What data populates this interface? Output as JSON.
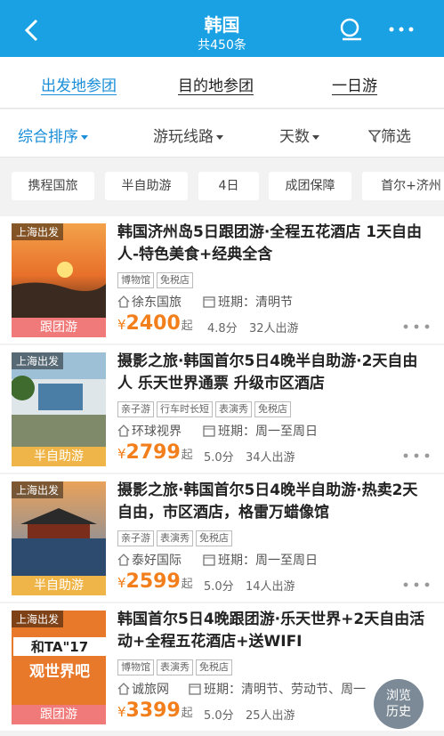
{
  "header": {
    "title": "韩国",
    "count": "共450条",
    "back_icon": "back-arrow-icon",
    "search_icon": "search-icon",
    "more_icon": "more-dots-icon"
  },
  "tabs": [
    "出发地参团",
    "目的地参团",
    "一日游"
  ],
  "filters": [
    "综合排序",
    "游玩线路",
    "天数",
    "筛选"
  ],
  "chips": [
    "携程国旅",
    "半自助游",
    "4日",
    "成团保障",
    "首尔+济州"
  ],
  "products": [
    {
      "origin": "上海出发",
      "title": "韩国济州岛5日跟团游·全程五花酒店 1天自由人-特色美食+经典全含",
      "badges": [
        "博物馆",
        "免税店"
      ],
      "agency": "徐东国旅",
      "schedule": "班期：清明节",
      "yen": "¥",
      "price": "2400",
      "qi": "起",
      "score": "4.8分",
      "travelers": "32人出游",
      "tag": "跟团游"
    },
    {
      "origin": "上海出发",
      "title": "摄影之旅·韩国首尔5日4晚半自助游·2天自由人 乐天世界通票 升级市区酒店",
      "badges": [
        "亲子游",
        "行车时长短",
        "表演秀",
        "免税店"
      ],
      "agency": "环球视界",
      "schedule": "班期：周一至周日",
      "yen": "¥",
      "price": "2799",
      "qi": "起",
      "score": "5.0分",
      "travelers": "34人出游",
      "tag": "半自助游"
    },
    {
      "origin": "上海出发",
      "title": "摄影之旅·韩国首尔5日4晚半自助游·热卖2天自由，市区酒店，格雷万蜡像馆",
      "badges": [
        "亲子游",
        "表演秀",
        "免税店"
      ],
      "agency": "泰好国际",
      "schedule": "班期：周一至周日",
      "yen": "¥",
      "price": "2599",
      "qi": "起",
      "score": "5.0分",
      "travelers": "14人出游",
      "tag": "半自助游"
    },
    {
      "origin": "上海出发",
      "title": "韩国首尔5日4晚跟团游·乐天世界+2天自由活动+全程五花酒店+送WIFI",
      "badges": [
        "博物馆",
        "表演秀",
        "免税店"
      ],
      "agency": "诚旅网",
      "schedule": "班期：清明节、劳动节、周一",
      "yen": "¥",
      "price": "3399",
      "qi": "起",
      "score": "5.0分",
      "travelers": "25人出游",
      "tag": "跟团游",
      "thumb_text": [
        "和TA\"17",
        "观世界吧"
      ]
    }
  ],
  "history_button": [
    "浏览",
    "历史"
  ],
  "colors": {
    "header": "#1aa1e3",
    "accent": "#1a8ed8",
    "price": "#f27f1b",
    "tag_group": "#f07a7a",
    "tag_semi": "#f0b548"
  }
}
